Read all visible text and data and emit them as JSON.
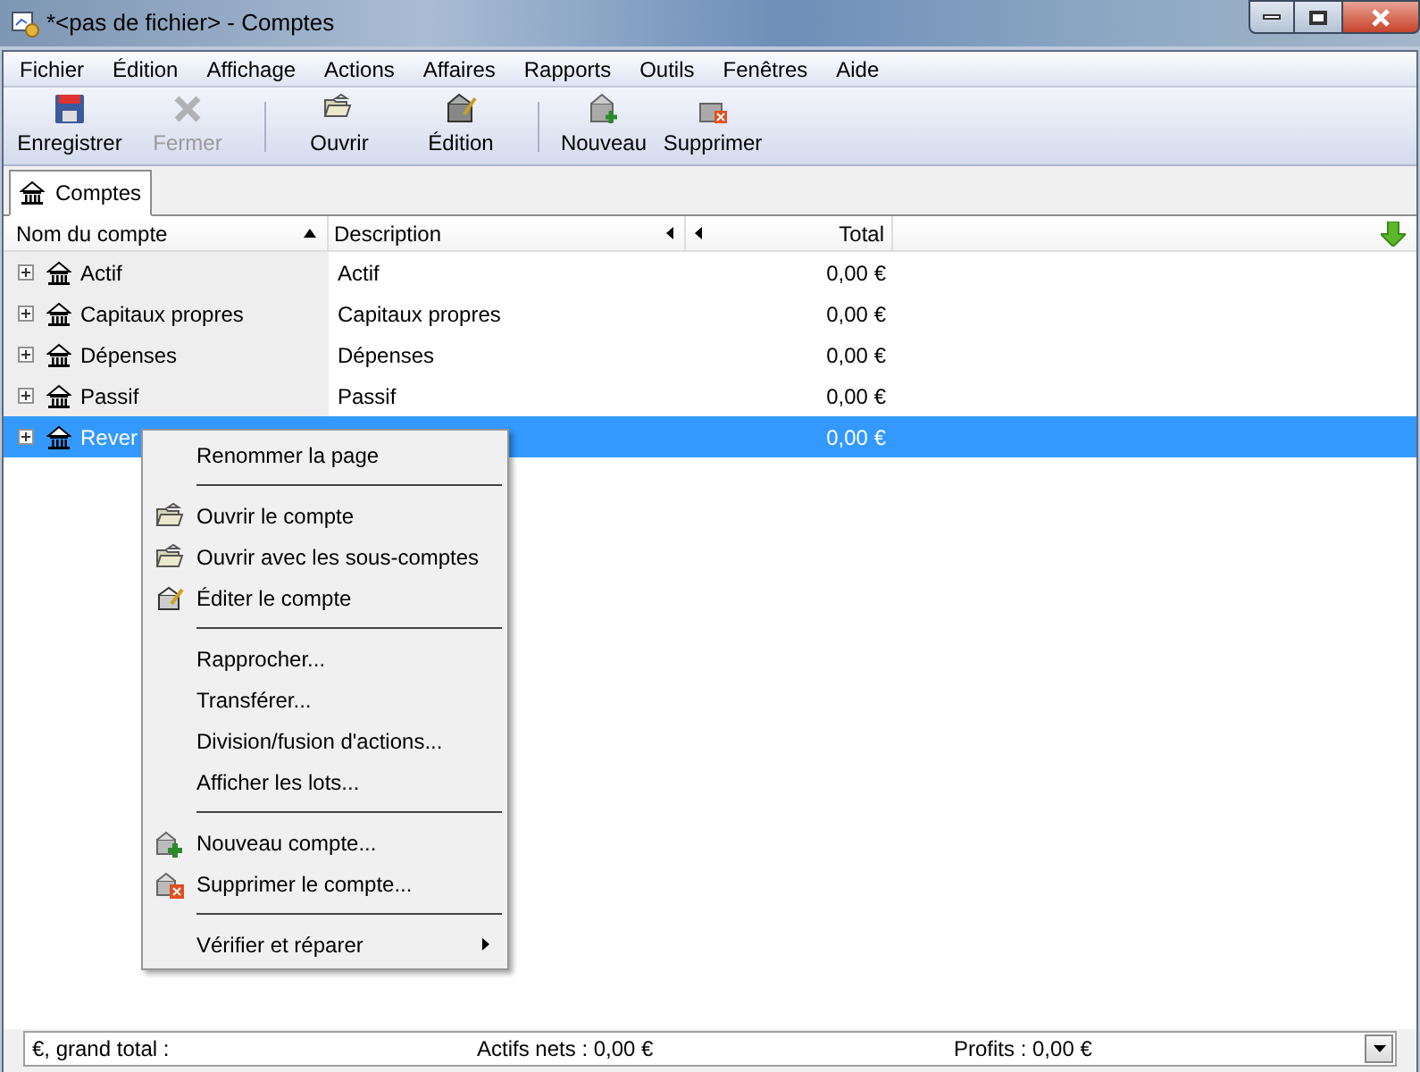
{
  "window": {
    "title": "*<pas de fichier> - Comptes"
  },
  "menu_bar": [
    "Fichier",
    "Édition",
    "Affichage",
    "Actions",
    "Affaires",
    "Rapports",
    "Outils",
    "Fenêtres",
    "Aide"
  ],
  "toolbar": [
    {
      "label": "Enregistrer",
      "disabled": false
    },
    {
      "label": "Fermer",
      "disabled": true
    },
    {
      "label": "Ouvrir",
      "disabled": false
    },
    {
      "label": "Édition",
      "disabled": false
    },
    {
      "label": "Nouveau",
      "disabled": false
    },
    {
      "label": "Supprimer",
      "disabled": false
    }
  ],
  "tabs": [
    {
      "label": "Comptes",
      "selected": true
    }
  ],
  "table": {
    "columns": [
      "Nom du compte",
      "Description",
      "Total"
    ],
    "rows": [
      {
        "name": "Actif",
        "description": "Actif",
        "total": "0,00 €",
        "selected": false
      },
      {
        "name": "Capitaux propres",
        "description": "Capitaux propres",
        "total": "0,00 €",
        "selected": false
      },
      {
        "name": "Dépenses",
        "description": "Dépenses",
        "total": "0,00 €",
        "selected": false
      },
      {
        "name": "Passif",
        "description": "Passif",
        "total": "0,00 €",
        "selected": false
      },
      {
        "name": "Rever",
        "total": "0,00 €",
        "selected": true
      }
    ]
  },
  "context_menu": [
    {
      "kind": "plain",
      "label": "Renommer la page"
    },
    {
      "kind": "separator"
    },
    {
      "kind": "open",
      "label": "Ouvrir le compte"
    },
    {
      "kind": "open",
      "label": "Ouvrir avec les sous-comptes"
    },
    {
      "kind": "edit",
      "label": "Éditer le compte"
    },
    {
      "kind": "separator"
    },
    {
      "kind": "plain",
      "label": "Rapprocher..."
    },
    {
      "kind": "plain",
      "label": "Transférer..."
    },
    {
      "kind": "plain",
      "label": "Division/fusion d'actions..."
    },
    {
      "kind": "plain",
      "label": "Afficher les lots..."
    },
    {
      "kind": "separator"
    },
    {
      "kind": "new",
      "label": "Nouveau compte..."
    },
    {
      "kind": "delete",
      "label": "Supprimer le compte..."
    },
    {
      "kind": "separator"
    },
    {
      "kind": "submenu",
      "label": "Vérifier et réparer"
    }
  ],
  "status_bar": {
    "grand_total": "€, grand total :",
    "net_assets": "Actifs nets : 0,00 €",
    "profits": "Profits : 0,00 €"
  }
}
